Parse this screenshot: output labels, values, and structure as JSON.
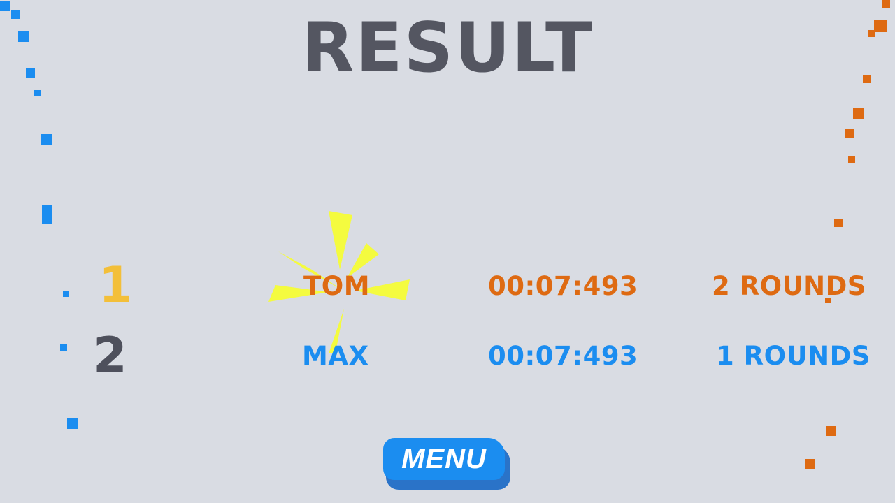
{
  "screen": {
    "title": "RESULT"
  },
  "colors": {
    "background": "#d9dce3",
    "title": "#545661",
    "blue": "#1b8df0",
    "orange": "#de6a12",
    "gold": "#f3bf39",
    "burst": "#f4fb3f"
  },
  "results": [
    {
      "rank": "1",
      "name": "TOM",
      "time": "00:07:493",
      "rounds": "2 ROUNDS",
      "team": "orange"
    },
    {
      "rank": "2",
      "name": "MAX",
      "time": "00:07:493",
      "rounds": "1 ROUNDS",
      "team": "blue"
    }
  ],
  "menu": {
    "label": "MENU"
  },
  "decor": {
    "winner_highlight": "starburst",
    "left_trail": "blue",
    "right_trail": "orange"
  }
}
